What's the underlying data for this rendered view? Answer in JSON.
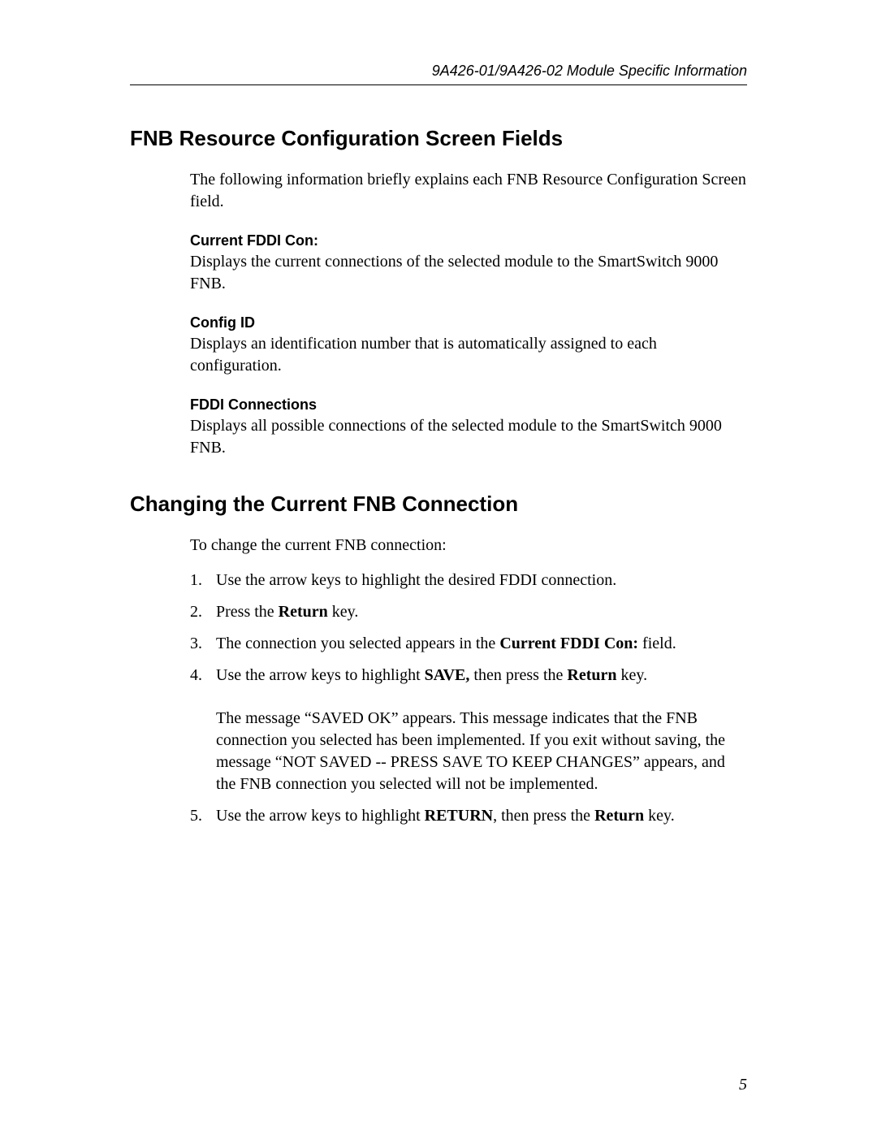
{
  "header": {
    "running_title": "9A426-01/9A426-02 Module Specific Information"
  },
  "section1": {
    "heading": "FNB Resource Configuration Screen Fields",
    "intro": "The following information briefly explains each FNB Resource Configuration Screen field.",
    "fields": [
      {
        "label": "Current FDDI Con:",
        "desc": "Displays the current connections of the selected module to the SmartSwitch 9000 FNB."
      },
      {
        "label": "Config ID",
        "desc": "Displays an identification number that is automatically assigned to each configuration."
      },
      {
        "label": "FDDI Connections",
        "desc": "Displays all possible connections of the selected module to the SmartSwitch 9000 FNB."
      }
    ]
  },
  "section2": {
    "heading": "Changing the Current FNB Connection",
    "intro": "To change the current FNB connection:",
    "steps": {
      "s1": "Use the arrow keys to highlight the desired FDDI connection.",
      "s2_a": "Press the ",
      "s2_b": "Return",
      "s2_c": " key.",
      "s3_a": "The connection you selected appears in the ",
      "s3_b": "Current FDDI Con:",
      "s3_c": " field.",
      "s4_a": "Use the arrow keys to highlight ",
      "s4_b": "SAVE,",
      "s4_c": " then press the ",
      "s4_d": "Return",
      "s4_e": " key.",
      "s4_extra": "The message “SAVED OK” appears. This message indicates that the FNB connection you selected has been implemented. If you exit without saving, the message “NOT SAVED -- PRESS SAVE TO KEEP CHANGES” appears, and the FNB connection you selected will not be implemented.",
      "s5_a": "Use the arrow keys to highlight ",
      "s5_b": "RETURN",
      "s5_c": ", then press the ",
      "s5_d": "Return",
      "s5_e": " key."
    }
  },
  "page_number": "5"
}
